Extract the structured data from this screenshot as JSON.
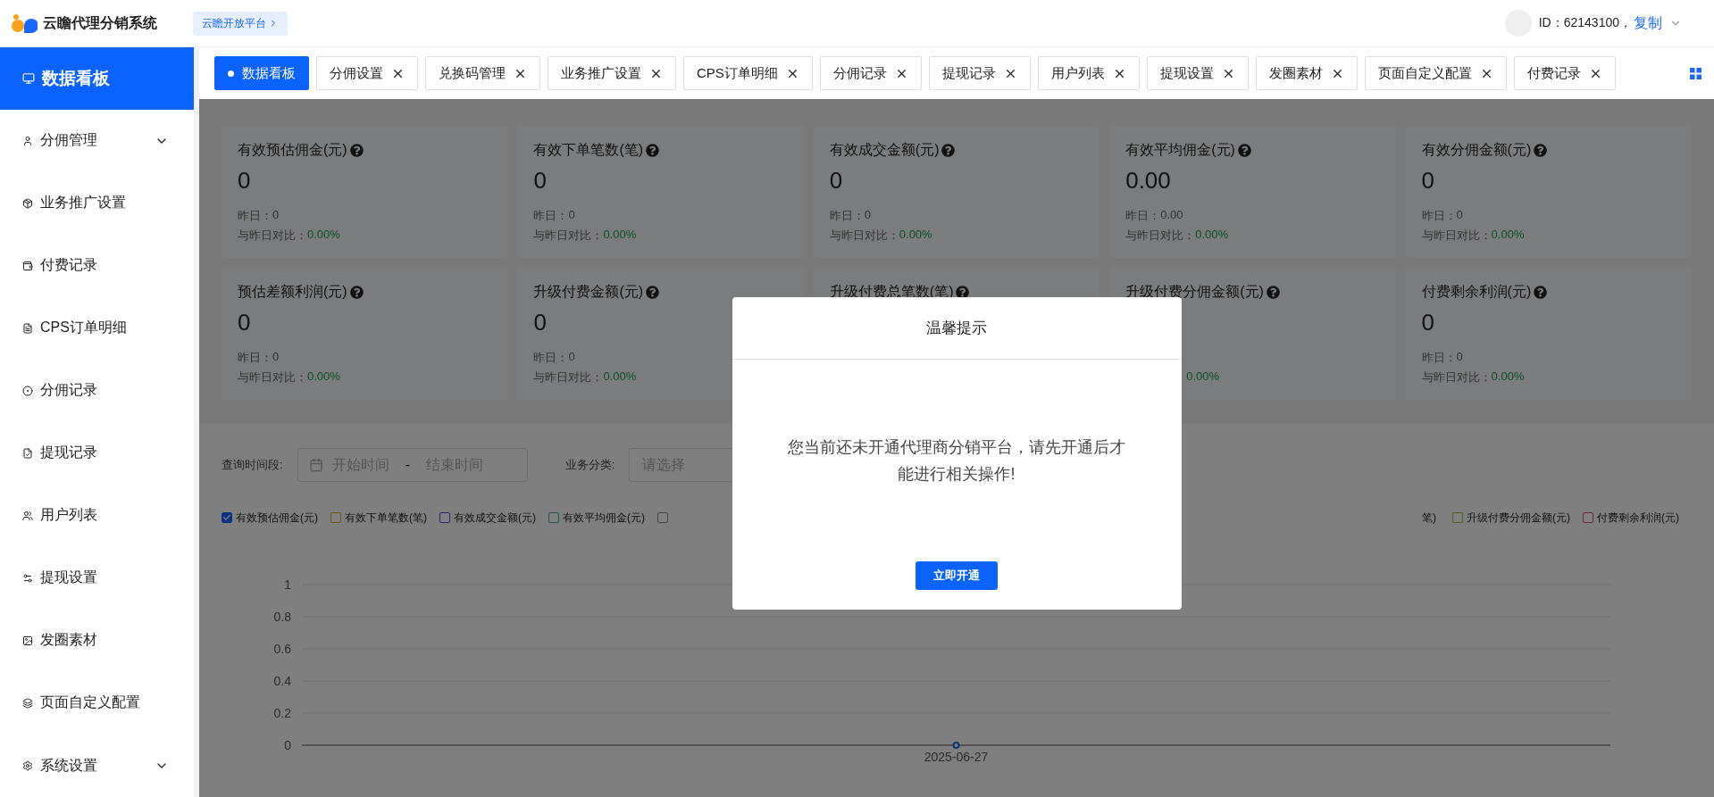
{
  "header": {
    "app_name": "云瞻代理分销系统",
    "platform_link": "云瞻开放平台",
    "user_id": "ID：62143100，",
    "copy_link": "复制"
  },
  "sidebar": {
    "items": [
      {
        "label": "数据看板",
        "kind": "link",
        "selected": true
      },
      {
        "label": "分佣管理",
        "kind": "group",
        "expanded": false,
        "selected": false
      },
      {
        "label": "业务推广设置",
        "kind": "link",
        "selected": false
      },
      {
        "label": "付费记录",
        "kind": "link",
        "selected": false
      },
      {
        "label": "CPS订单明细",
        "kind": "link",
        "selected": false
      },
      {
        "label": "分佣记录",
        "kind": "link",
        "selected": false
      },
      {
        "label": "提现记录",
        "kind": "link",
        "selected": false
      },
      {
        "label": "用户列表",
        "kind": "link",
        "selected": false
      },
      {
        "label": "提现设置",
        "kind": "link",
        "selected": false
      },
      {
        "label": "发圈素材",
        "kind": "link",
        "selected": false
      },
      {
        "label": "页面自定义配置",
        "kind": "link",
        "selected": false
      },
      {
        "label": "系统设置",
        "kind": "group",
        "expanded": false,
        "selected": false
      }
    ]
  },
  "tabs": [
    {
      "label": "数据看板",
      "selected": true
    },
    {
      "label": "分佣设置",
      "selected": false
    },
    {
      "label": "兑换码管理",
      "selected": false
    },
    {
      "label": "业务推广设置",
      "selected": false
    },
    {
      "label": "CPS订单明细",
      "selected": false
    },
    {
      "label": "分佣记录",
      "selected": false
    },
    {
      "label": "提现记录",
      "selected": false
    },
    {
      "label": "用户列表",
      "selected": false
    },
    {
      "label": "提现设置",
      "selected": false
    },
    {
      "label": "发圈素材",
      "selected": false
    },
    {
      "label": "页面自定义配置",
      "selected": false
    },
    {
      "label": "付费记录",
      "selected": false
    }
  ],
  "stats": [
    {
      "title": "有效预估佣金(元)",
      "value": "0",
      "yesterday_label": "昨日：",
      "yesterday": "0",
      "compare_label": "与昨日对比：",
      "compare": "0.00%"
    },
    {
      "title": "有效下单笔数(笔)",
      "value": "0",
      "yesterday_label": "昨日：",
      "yesterday": "0",
      "compare_label": "与昨日对比：",
      "compare": "0.00%"
    },
    {
      "title": "有效成交金额(元)",
      "value": "0",
      "yesterday_label": "昨日：",
      "yesterday": "0",
      "compare_label": "与昨日对比：",
      "compare": "0.00%"
    },
    {
      "title": "有效平均佣金(元)",
      "value": "0.00",
      "yesterday_label": "昨日：",
      "yesterday": "0.00",
      "compare_label": "与昨日对比：",
      "compare": "0.00%"
    },
    {
      "title": "有效分佣金额(元)",
      "value": "0",
      "yesterday_label": "昨日：",
      "yesterday": "0",
      "compare_label": "与昨日对比：",
      "compare": "0.00%"
    },
    {
      "title": "预估差额利润(元)",
      "value": "0",
      "yesterday_label": "昨日：",
      "yesterday": "0",
      "compare_label": "与昨日对比：",
      "compare": "0.00%"
    },
    {
      "title": "升级付费金额(元)",
      "value": "0",
      "yesterday_label": "昨日：",
      "yesterday": "0",
      "compare_label": "与昨日对比：",
      "compare": "0.00%"
    },
    {
      "title": "升级付费总笔数(笔)"
    },
    {
      "title": "升级付费分佣金额(元)",
      "compare": "0.00%"
    },
    {
      "title": "付费剩余利润(元)",
      "value": "0",
      "yesterday_label": "昨日：",
      "yesterday": "0",
      "compare_label": "与昨日对比：",
      "compare": "0.00%"
    }
  ],
  "filters": {
    "time_label": "查询时间段:",
    "start_placeholder": "开始时间",
    "separator": "-",
    "end_placeholder": "结束时间",
    "category_label": "业务分类:",
    "category_placeholder": "请选择"
  },
  "legend": {
    "left": [
      {
        "kind": "series",
        "checked": true,
        "color": "#0d3380"
      },
      {
        "label": "有效下单笔数(笔)",
        "checked": false,
        "color": "#705417"
      },
      {
        "label": "有效成交金额(元)",
        "checked": false,
        "color": "#351e74"
      },
      {
        "label": "有效平均佣金(元)",
        "checked": false,
        "color": "#1d5350"
      },
      {
        "checked": false,
        "color": "#454545"
      }
    ],
    "fragment": "笔)",
    "right": [
      {
        "label": "升级付费分佣金额(元)",
        "checked": false,
        "color": "#466225"
      },
      {
        "label": "付费剩余利润(元)",
        "checked": false,
        "color": "#682d35"
      }
    ]
  },
  "chart_data": {
    "type": "line",
    "categories": [
      "2025-06-27"
    ],
    "grid": true,
    "series": [
      {
        "name": "有效预估佣金(元)",
        "color": "#1a66ff",
        "marker": "circle",
        "values": [
          0
        ]
      }
    ],
    "ylim": [
      0,
      1
    ],
    "yticks": [
      0,
      0.2,
      0.4,
      0.6,
      0.8,
      1
    ]
  },
  "dialog": {
    "title": "温馨提示",
    "message": "您当前还未开通代理商分销平台，请先开通后才能进行相关操作!",
    "button": "立即开通"
  }
}
